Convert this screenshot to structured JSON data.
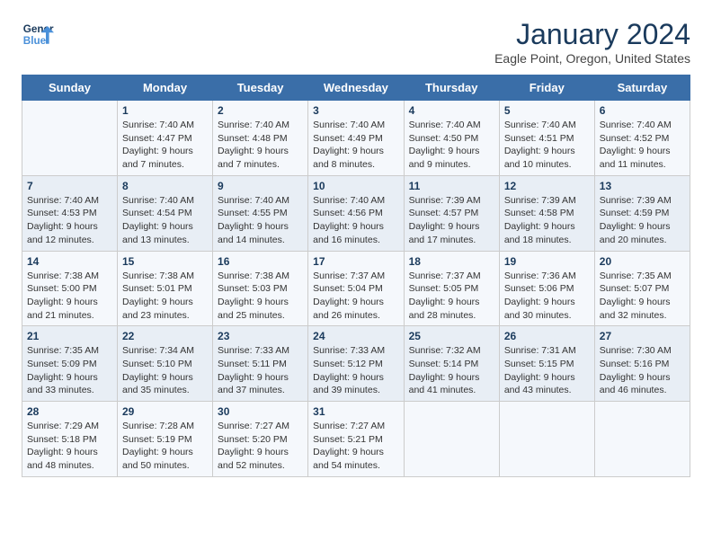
{
  "logo": {
    "text_general": "General",
    "text_blue": "Blue"
  },
  "calendar": {
    "title": "January 2024",
    "subtitle": "Eagle Point, Oregon, United States",
    "headers": [
      "Sunday",
      "Monday",
      "Tuesday",
      "Wednesday",
      "Thursday",
      "Friday",
      "Saturday"
    ],
    "weeks": [
      [
        {
          "day": "",
          "sunrise": "",
          "sunset": "",
          "daylight": ""
        },
        {
          "day": "1",
          "sunrise": "Sunrise: 7:40 AM",
          "sunset": "Sunset: 4:47 PM",
          "daylight": "Daylight: 9 hours and 7 minutes."
        },
        {
          "day": "2",
          "sunrise": "Sunrise: 7:40 AM",
          "sunset": "Sunset: 4:48 PM",
          "daylight": "Daylight: 9 hours and 7 minutes."
        },
        {
          "day": "3",
          "sunrise": "Sunrise: 7:40 AM",
          "sunset": "Sunset: 4:49 PM",
          "daylight": "Daylight: 9 hours and 8 minutes."
        },
        {
          "day": "4",
          "sunrise": "Sunrise: 7:40 AM",
          "sunset": "Sunset: 4:50 PM",
          "daylight": "Daylight: 9 hours and 9 minutes."
        },
        {
          "day": "5",
          "sunrise": "Sunrise: 7:40 AM",
          "sunset": "Sunset: 4:51 PM",
          "daylight": "Daylight: 9 hours and 10 minutes."
        },
        {
          "day": "6",
          "sunrise": "Sunrise: 7:40 AM",
          "sunset": "Sunset: 4:52 PM",
          "daylight": "Daylight: 9 hours and 11 minutes."
        }
      ],
      [
        {
          "day": "7",
          "sunrise": "Sunrise: 7:40 AM",
          "sunset": "Sunset: 4:53 PM",
          "daylight": "Daylight: 9 hours and 12 minutes."
        },
        {
          "day": "8",
          "sunrise": "Sunrise: 7:40 AM",
          "sunset": "Sunset: 4:54 PM",
          "daylight": "Daylight: 9 hours and 13 minutes."
        },
        {
          "day": "9",
          "sunrise": "Sunrise: 7:40 AM",
          "sunset": "Sunset: 4:55 PM",
          "daylight": "Daylight: 9 hours and 14 minutes."
        },
        {
          "day": "10",
          "sunrise": "Sunrise: 7:40 AM",
          "sunset": "Sunset: 4:56 PM",
          "daylight": "Daylight: 9 hours and 16 minutes."
        },
        {
          "day": "11",
          "sunrise": "Sunrise: 7:39 AM",
          "sunset": "Sunset: 4:57 PM",
          "daylight": "Daylight: 9 hours and 17 minutes."
        },
        {
          "day": "12",
          "sunrise": "Sunrise: 7:39 AM",
          "sunset": "Sunset: 4:58 PM",
          "daylight": "Daylight: 9 hours and 18 minutes."
        },
        {
          "day": "13",
          "sunrise": "Sunrise: 7:39 AM",
          "sunset": "Sunset: 4:59 PM",
          "daylight": "Daylight: 9 hours and 20 minutes."
        }
      ],
      [
        {
          "day": "14",
          "sunrise": "Sunrise: 7:38 AM",
          "sunset": "Sunset: 5:00 PM",
          "daylight": "Daylight: 9 hours and 21 minutes."
        },
        {
          "day": "15",
          "sunrise": "Sunrise: 7:38 AM",
          "sunset": "Sunset: 5:01 PM",
          "daylight": "Daylight: 9 hours and 23 minutes."
        },
        {
          "day": "16",
          "sunrise": "Sunrise: 7:38 AM",
          "sunset": "Sunset: 5:03 PM",
          "daylight": "Daylight: 9 hours and 25 minutes."
        },
        {
          "day": "17",
          "sunrise": "Sunrise: 7:37 AM",
          "sunset": "Sunset: 5:04 PM",
          "daylight": "Daylight: 9 hours and 26 minutes."
        },
        {
          "day": "18",
          "sunrise": "Sunrise: 7:37 AM",
          "sunset": "Sunset: 5:05 PM",
          "daylight": "Daylight: 9 hours and 28 minutes."
        },
        {
          "day": "19",
          "sunrise": "Sunrise: 7:36 AM",
          "sunset": "Sunset: 5:06 PM",
          "daylight": "Daylight: 9 hours and 30 minutes."
        },
        {
          "day": "20",
          "sunrise": "Sunrise: 7:35 AM",
          "sunset": "Sunset: 5:07 PM",
          "daylight": "Daylight: 9 hours and 32 minutes."
        }
      ],
      [
        {
          "day": "21",
          "sunrise": "Sunrise: 7:35 AM",
          "sunset": "Sunset: 5:09 PM",
          "daylight": "Daylight: 9 hours and 33 minutes."
        },
        {
          "day": "22",
          "sunrise": "Sunrise: 7:34 AM",
          "sunset": "Sunset: 5:10 PM",
          "daylight": "Daylight: 9 hours and 35 minutes."
        },
        {
          "day": "23",
          "sunrise": "Sunrise: 7:33 AM",
          "sunset": "Sunset: 5:11 PM",
          "daylight": "Daylight: 9 hours and 37 minutes."
        },
        {
          "day": "24",
          "sunrise": "Sunrise: 7:33 AM",
          "sunset": "Sunset: 5:12 PM",
          "daylight": "Daylight: 9 hours and 39 minutes."
        },
        {
          "day": "25",
          "sunrise": "Sunrise: 7:32 AM",
          "sunset": "Sunset: 5:14 PM",
          "daylight": "Daylight: 9 hours and 41 minutes."
        },
        {
          "day": "26",
          "sunrise": "Sunrise: 7:31 AM",
          "sunset": "Sunset: 5:15 PM",
          "daylight": "Daylight: 9 hours and 43 minutes."
        },
        {
          "day": "27",
          "sunrise": "Sunrise: 7:30 AM",
          "sunset": "Sunset: 5:16 PM",
          "daylight": "Daylight: 9 hours and 46 minutes."
        }
      ],
      [
        {
          "day": "28",
          "sunrise": "Sunrise: 7:29 AM",
          "sunset": "Sunset: 5:18 PM",
          "daylight": "Daylight: 9 hours and 48 minutes."
        },
        {
          "day": "29",
          "sunrise": "Sunrise: 7:28 AM",
          "sunset": "Sunset: 5:19 PM",
          "daylight": "Daylight: 9 hours and 50 minutes."
        },
        {
          "day": "30",
          "sunrise": "Sunrise: 7:27 AM",
          "sunset": "Sunset: 5:20 PM",
          "daylight": "Daylight: 9 hours and 52 minutes."
        },
        {
          "day": "31",
          "sunrise": "Sunrise: 7:27 AM",
          "sunset": "Sunset: 5:21 PM",
          "daylight": "Daylight: 9 hours and 54 minutes."
        },
        {
          "day": "",
          "sunrise": "",
          "sunset": "",
          "daylight": ""
        },
        {
          "day": "",
          "sunrise": "",
          "sunset": "",
          "daylight": ""
        },
        {
          "day": "",
          "sunrise": "",
          "sunset": "",
          "daylight": ""
        }
      ]
    ]
  }
}
